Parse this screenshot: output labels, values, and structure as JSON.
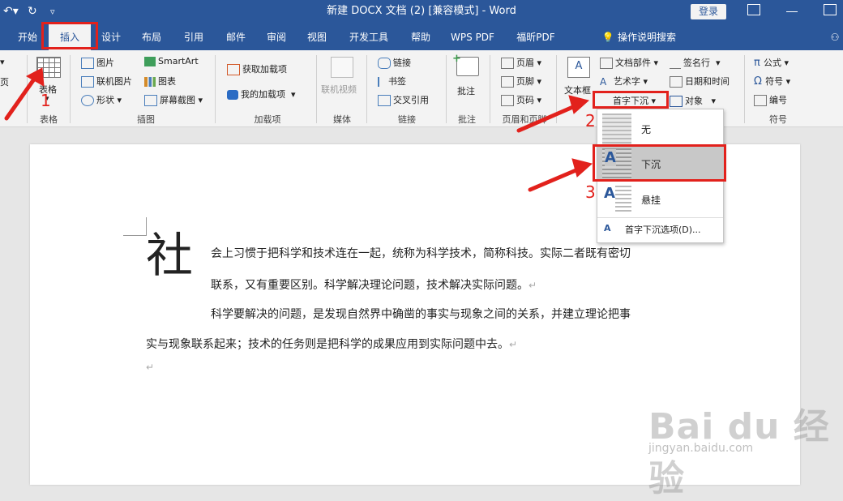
{
  "window": {
    "title": "新建 DOCX 文档 (2) [兼容模式] - Word",
    "login": "登录"
  },
  "tabs": [
    "开始",
    "插入",
    "设计",
    "布局",
    "引用",
    "邮件",
    "审阅",
    "视图",
    "开发工具",
    "帮助",
    "WPS PDF",
    "福昕PDF"
  ],
  "tell_me": "操作说明搜索",
  "ribbon": {
    "left_partial_top": "▾",
    "left_partial_mid": "页",
    "table_label": "表格",
    "table_group": "表格",
    "illus": {
      "picture": "图片",
      "online_picture": "联机图片",
      "shapes": "形状",
      "smartart": "SmartArt",
      "chart": "图表",
      "screenshot": "屏幕截图",
      "group": "插图"
    },
    "addins": {
      "get": "获取加载项",
      "mine": "我的加载项",
      "group": "加载项"
    },
    "media": {
      "online_video": "联机视频",
      "group": "媒体"
    },
    "links": {
      "link": "链接",
      "bookmark": "书签",
      "cross_ref": "交叉引用",
      "group": "链接"
    },
    "comments": {
      "comment": "批注",
      "group": "批注"
    },
    "header_footer": {
      "header": "页眉",
      "footer": "页脚",
      "page_number": "页码",
      "group": "页眉和页脚"
    },
    "text": {
      "textbox": "文本框",
      "doc_parts": "文档部件",
      "wordart": "艺术字",
      "dropcap": "首字下沉",
      "signature": "签名行",
      "datetime": "日期和时间",
      "object": "对象"
    },
    "symbols": {
      "equation": "公式",
      "symbol": "符号",
      "number": "编号",
      "group": "符号"
    }
  },
  "dropcap_menu": {
    "none": "无",
    "dropped": "下沉",
    "inmargin": "悬挂",
    "options": "首字下沉选项(D)..."
  },
  "document": {
    "dropcap_char": "社",
    "p1_line1": "会上习惯于把科学和技术连在一起，统称为科学技术，简称科技。实际二者既有密切",
    "p1_line2": "联系，又有重要区别。科学解决理论问题，技术解决实际问题。",
    "p2_line1": "科学要解决的问题，是发现自然界中确凿的事实与现象之间的关系，并建立理论把事",
    "p2_line2": "实与现象联系起来；技术的任务则是把科学的成果应用到实际问题中去。",
    "return_mark": "↵"
  },
  "annotations": {
    "n1": "1",
    "n2": "2",
    "n3": "3"
  },
  "watermark": {
    "brand": "Bai du 经验",
    "url": "jingyan.baidu.com"
  },
  "colors": {
    "accent": "#2b579a",
    "annotation": "#e2211c"
  }
}
